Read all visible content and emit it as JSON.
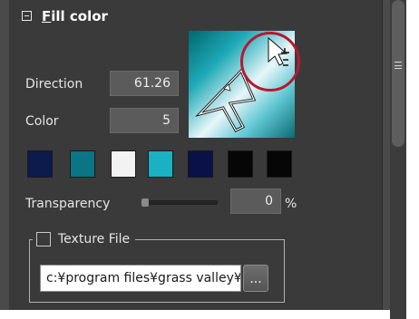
{
  "section": {
    "title_mnemonic": "F",
    "title_rest": "ill color",
    "expanded": true
  },
  "direction": {
    "label": "Direction",
    "value": "61.26"
  },
  "color": {
    "label": "Color",
    "value": "5"
  },
  "swatches": [
    {
      "name": "navy",
      "color": "#0c1a4c"
    },
    {
      "name": "teal",
      "color": "#097585"
    },
    {
      "name": "white",
      "color": "#f2f2f2"
    },
    {
      "name": "cyan",
      "color": "#1bb1c4"
    },
    {
      "name": "indigo",
      "color": "#0a1147"
    },
    {
      "name": "black",
      "color": "#060606"
    },
    {
      "name": "black-2",
      "color": "#060606"
    }
  ],
  "transparency": {
    "label": "Transparency",
    "value": "0",
    "unit": "%",
    "level": 0
  },
  "texture": {
    "label": "Texture File",
    "checked": false,
    "path": "c:¥program files¥grass valley¥",
    "browse_label": "..."
  },
  "preview": {
    "gradient_start": "#00686e",
    "gradient_mid": "#e8f6f8",
    "gradient_end": "#0b6b72",
    "highlight_color": "#b5192f"
  }
}
